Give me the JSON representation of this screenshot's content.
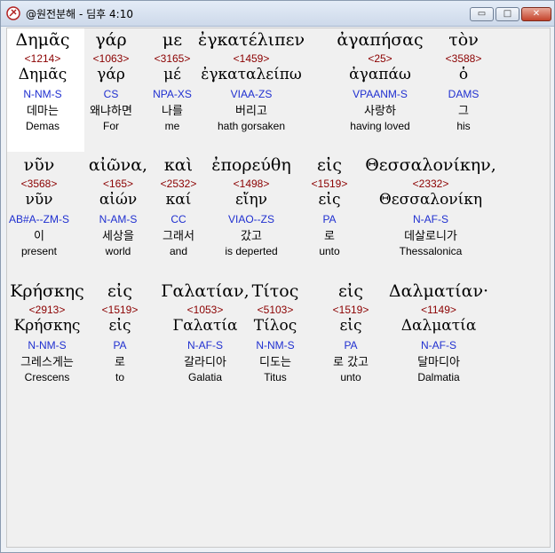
{
  "window": {
    "title": "@원전분해 - 딤후 4:10",
    "controls": {
      "minimize": "▭",
      "maximize": "□",
      "close": "✕"
    }
  },
  "rows": [
    {
      "words": [
        {
          "greek": "Δημᾶς",
          "strong": "<1214>",
          "lemma": "Δημᾶς",
          "morph": "N-NM-S",
          "korean": "데마는",
          "english": "Demas"
        },
        {
          "greek": "γάρ",
          "strong": "<1063>",
          "lemma": "γάρ",
          "morph": "CS",
          "korean": "왜냐하면",
          "english": "For"
        },
        {
          "greek": "με",
          "strong": "<3165>",
          "lemma": "μέ",
          "morph": "NPA-XS",
          "korean": "나를",
          "english": "me"
        },
        {
          "greek": "ἐγκατέλιπεν",
          "strong": "<1459>",
          "lemma": "ἐγκαταλείπω",
          "morph": "VIAA-ZS",
          "korean": "버리고",
          "english": "hath gorsaken"
        },
        {
          "greek": "ἀγαπήσας",
          "strong": "<25>",
          "lemma": "ἀγαπάω",
          "morph": "VPAANM-S",
          "korean": "사랑하",
          "english": "having loved"
        },
        {
          "greek": "τὸν",
          "strong": "<3588>",
          "lemma": "ὁ",
          "morph": "DAMS",
          "korean": "그",
          "english": "his"
        }
      ]
    },
    {
      "words": [
        {
          "greek": "νῦν",
          "strong": "<3568>",
          "lemma": "νῦν",
          "morph": "AB#A--ZM-S",
          "korean": "이",
          "english": "present"
        },
        {
          "greek": "αἰῶνα,",
          "strong": "<165>",
          "lemma": "αἰών",
          "morph": "N-AM-S",
          "korean": "세상을",
          "english": "world"
        },
        {
          "greek": "καὶ",
          "strong": "<2532>",
          "lemma": "καί",
          "morph": "CC",
          "korean": "그래서",
          "english": "and"
        },
        {
          "greek": "ἐπορεύθη",
          "strong": "<1498>",
          "lemma": "εἴην",
          "morph": "VIAO--ZS",
          "korean": "갔고",
          "english": "is deperted"
        },
        {
          "greek": "εἰς",
          "strong": "<1519>",
          "lemma": "εἰς",
          "morph": "PA",
          "korean": "로",
          "english": "unto"
        },
        {
          "greek": "Θεσσαλονίκην,",
          "strong": "<2332>",
          "lemma": "Θεσσαλονίκη",
          "morph": "N-AF-S",
          "korean": "데살로니가",
          "english": "Thessalonica"
        }
      ]
    },
    {
      "words": [
        {
          "greek": "Κρήσκης",
          "strong": "<2913>",
          "lemma": "Κρήσκης",
          "morph": "N-NM-S",
          "korean": "그레스게는",
          "english": "Crescens"
        },
        {
          "greek": "εἰς",
          "strong": "<1519>",
          "lemma": "εἰς",
          "morph": "PA",
          "korean": "로",
          "english": "to"
        },
        {
          "greek": "Γαλατίαν,",
          "strong": "<1053>",
          "lemma": "Γαλατία",
          "morph": "N-AF-S",
          "korean": "갈라디아",
          "english": "Galatia"
        },
        {
          "greek": "Τίτος",
          "strong": "<5103>",
          "lemma": "Τίλος",
          "morph": "N-NM-S",
          "korean": "디도는",
          "english": "Titus"
        },
        {
          "greek": "εἰς",
          "strong": "<1519>",
          "lemma": "εἰς",
          "morph": "PA",
          "korean": "로 갔고",
          "english": "unto"
        },
        {
          "greek": "Δαλματίαν·",
          "strong": "<1149>",
          "lemma": "Δαλματία",
          "morph": "N-AF-S",
          "korean": "달마디아",
          "english": "Dalmatia"
        }
      ]
    }
  ]
}
